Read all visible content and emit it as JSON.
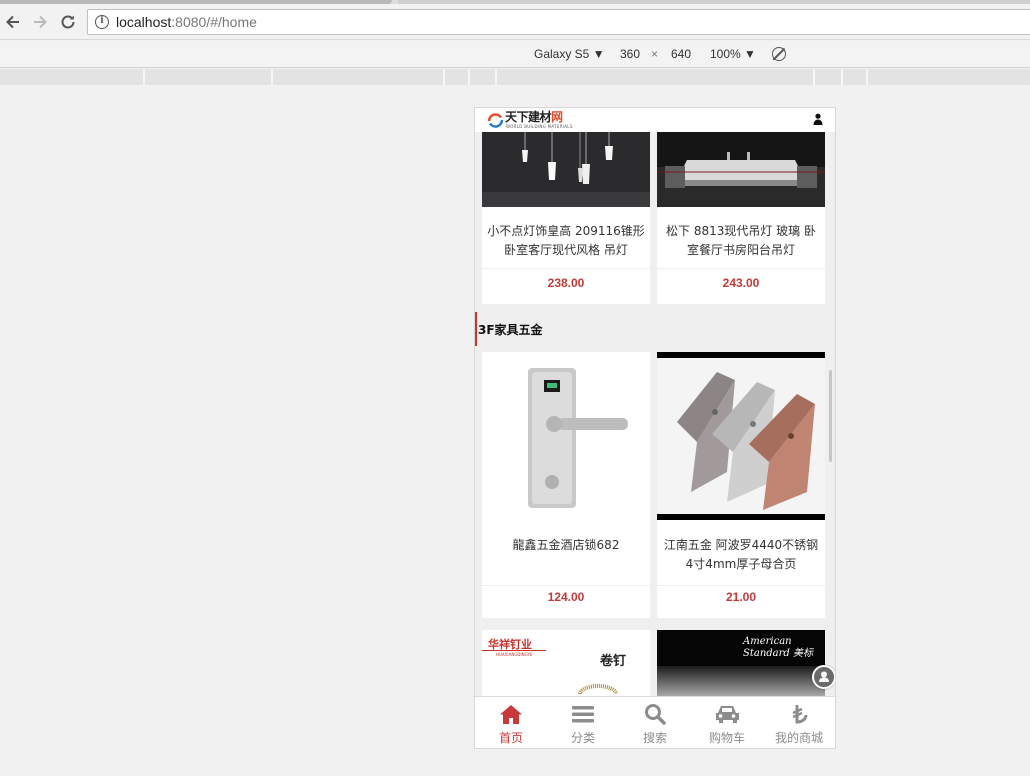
{
  "browser": {
    "url_host": "localhost",
    "url_rest": ":8080/#/home",
    "back_icon": "arrow-left-icon",
    "forward_icon": "arrow-right-icon",
    "reload_icon": "reload-icon"
  },
  "devtools": {
    "device": "Galaxy S5 ▼",
    "width": "360",
    "times": "×",
    "height": "640",
    "zoom": "100% ▼"
  },
  "app": {
    "logo_text_a": "天下建材",
    "logo_text_b": "网",
    "logo_sub": "WORLD BUILDING MATERIALS",
    "products_top": [
      {
        "name": "小不点灯饰皇高 209116锥形卧室客厅现代风格 吊灯",
        "price": "238.00"
      },
      {
        "name": "松下 8813现代吊灯 玻璃 卧室餐厅书房阳台吊灯",
        "price": "243.00"
      }
    ],
    "section_title": "3F家具五金",
    "products_hardware": [
      {
        "name": "龍鑫五金酒店锁682",
        "price": "124.00"
      },
      {
        "name": "江南五金 阿波罗4440不锈钢4寸4mm厚子母合页",
        "price": "21.00"
      }
    ],
    "products_bottom": [
      {
        "brand": "华祥钉业",
        "brand_en": "HUAXIANGDINGYE",
        "tag": "卷钉"
      },
      {
        "brand": "American Standard 美标"
      }
    ],
    "tabs": [
      {
        "label": "首页",
        "icon": "home-icon",
        "active": true
      },
      {
        "label": "分类",
        "icon": "menu-icon",
        "active": false
      },
      {
        "label": "搜索",
        "icon": "search-icon",
        "active": false
      },
      {
        "label": "购物车",
        "icon": "car-icon",
        "active": false
      },
      {
        "label": "我的商城",
        "icon": "lira-icon",
        "active": false
      }
    ],
    "colors": {
      "accent": "#c83a3a",
      "price": "#c03a3a",
      "section_bar": "#cc3333"
    }
  }
}
